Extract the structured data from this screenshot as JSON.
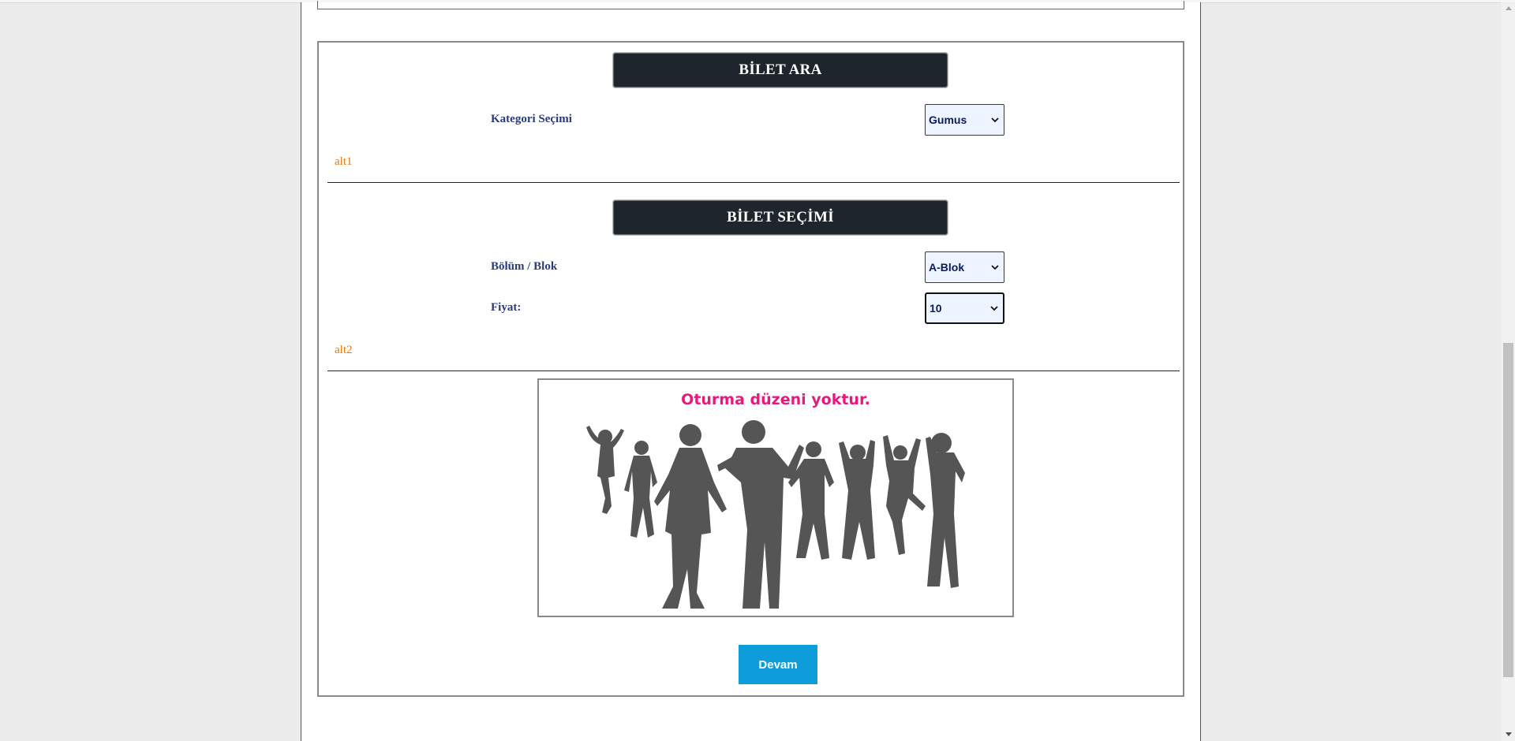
{
  "search_section": {
    "header": "BİLET ARA",
    "category_label": "Kategori Seçimi",
    "category_value": "Gumus",
    "footer_label": "alt1"
  },
  "selection_section": {
    "header": "BİLET SEÇİMİ",
    "section_label": "Bölüm / Blok",
    "section_value": "A-Blok",
    "price_label": "Fiyat:",
    "price_value": "10",
    "footer_label": "alt2"
  },
  "seating_image": {
    "caption": "Oturma düzeni yoktur.",
    "silhouette_color": "#555555",
    "caption_color": "#e8187f"
  },
  "actions": {
    "continue_label": "Devam"
  },
  "colors": {
    "header_bg": "#1f252d",
    "label_color": "#2b3a7a",
    "alt_color": "#e07b14",
    "button_bg": "#0d9ddb"
  }
}
